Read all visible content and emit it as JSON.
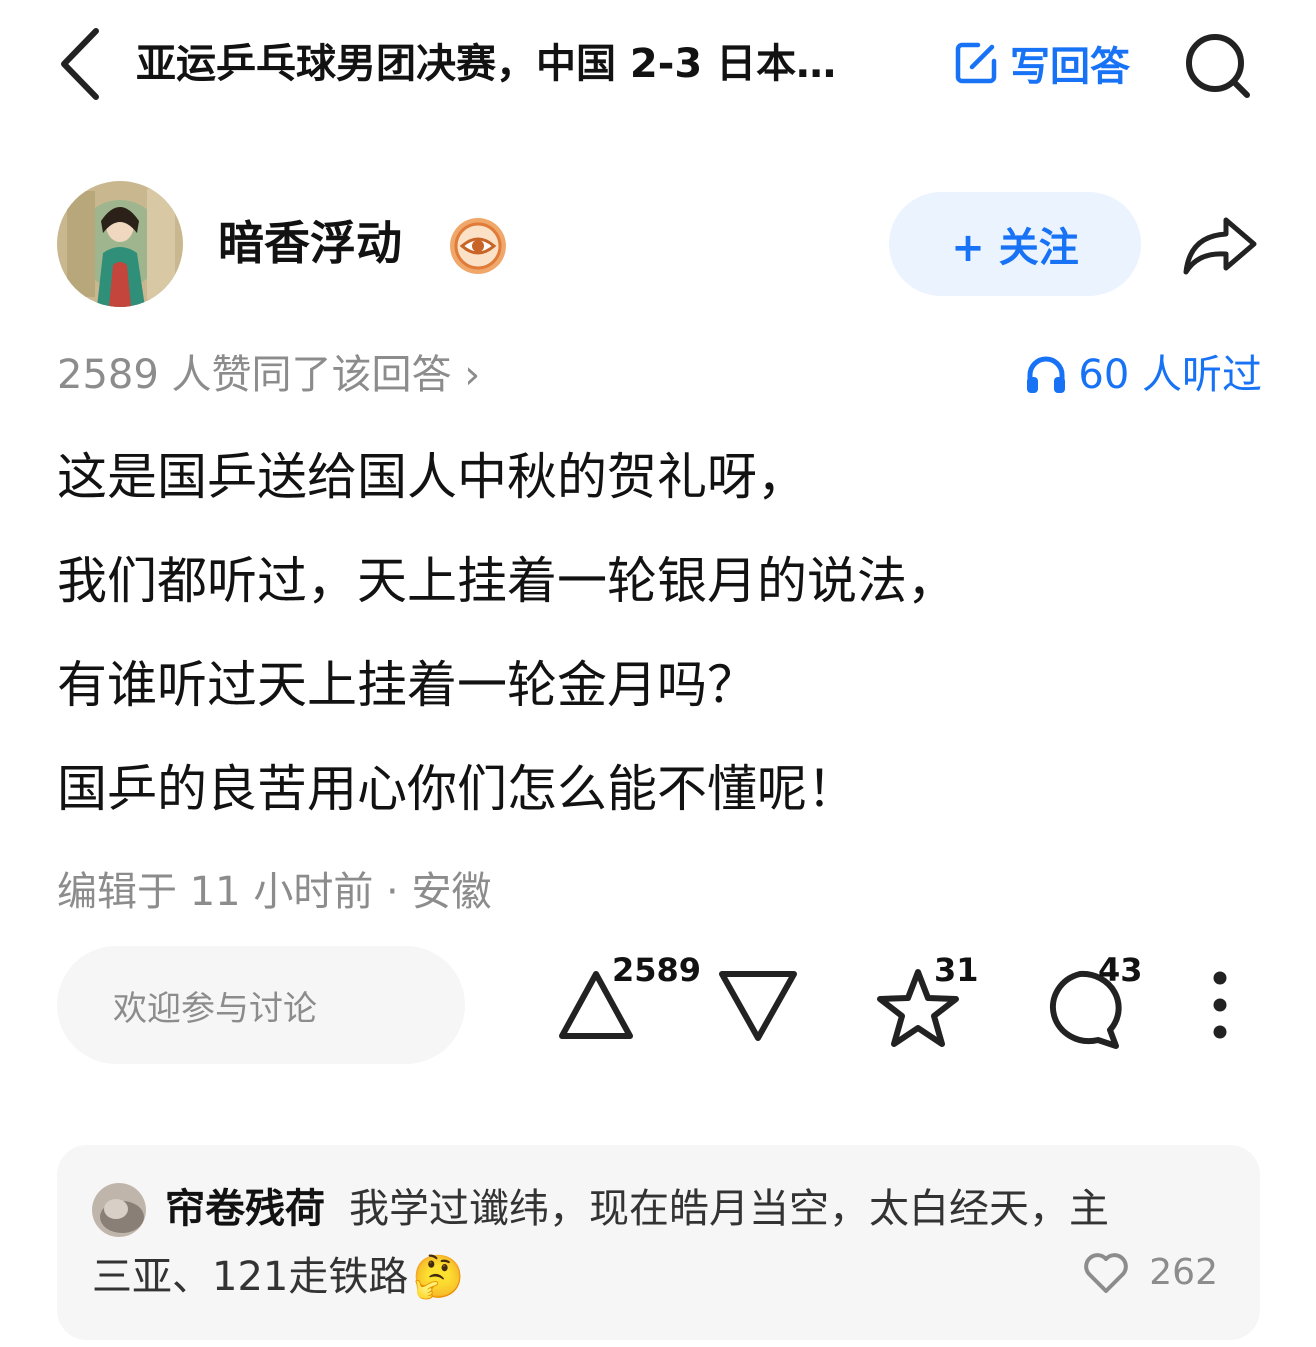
{
  "header": {
    "title": "亚运乒乓球男团决赛，中国 2-3 日本…",
    "write_answer_label": "写回答"
  },
  "author": {
    "name": "暗香浮动",
    "follow_label": "+ 关注"
  },
  "meta": {
    "voters_text": "2589 人赞同了该回答 ›",
    "listened_text": "60 人听过"
  },
  "answer": {
    "lines": [
      "这是国乒送给国人中秋的贺礼呀，",
      "我们都听过，天上挂着一轮银月的说法，",
      "有谁听过天上挂着一轮金月吗？",
      "国乒的良苦用心你们怎么能不懂呢！"
    ],
    "edit_info": "编辑于 11 小时前 · 安徽"
  },
  "actions": {
    "comment_placeholder": "欢迎参与讨论",
    "upvote_count": "2589",
    "star_count": "31",
    "comment_count": "43"
  },
  "top_comment": {
    "author": "帘卷残荷",
    "text_line1": "我学过谶纬，现在皓月当空，太白经天，主",
    "text_line2": "三亚、121走铁路",
    "emoji": "🤔",
    "likes": "262"
  },
  "colors": {
    "accent": "#1772f6",
    "muted": "#8c8c8c",
    "card_bg": "#f6f6f6",
    "follow_bg": "#ebf3fe"
  },
  "icons": [
    "back-icon",
    "edit-icon",
    "search-icon",
    "verified-badge-icon",
    "share-icon",
    "headphones-icon",
    "upvote-icon",
    "downvote-icon",
    "star-icon",
    "comment-icon",
    "more-icon",
    "heart-icon"
  ]
}
